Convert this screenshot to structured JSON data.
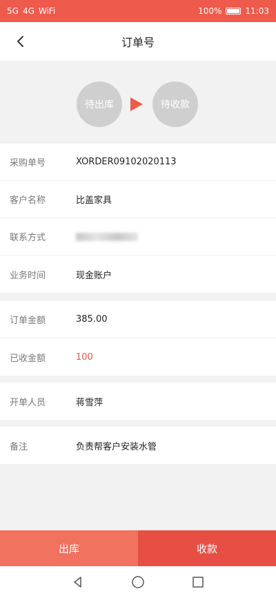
{
  "status_bar": {
    "left": [
      "5G",
      "4G",
      "WiFi"
    ],
    "battery": "100%",
    "time": "11:03"
  },
  "header": {
    "title": "订单号"
  },
  "flow": {
    "step1": "待出库",
    "step2": "待收款"
  },
  "info": [
    {
      "label": "采购单号",
      "value": "XORDER09102020113"
    },
    {
      "label": "客户名称",
      "value": "比盖家具"
    },
    {
      "label": "联系方式",
      "value": ""
    },
    {
      "label": "业务时间",
      "value": "现金账户"
    }
  ],
  "amounts": [
    {
      "label": "订单金额",
      "value": "385.00"
    },
    {
      "label": "已收金额",
      "value": "100"
    }
  ],
  "staff": [
    {
      "label": "开单人员",
      "value": "蒋雪萍"
    }
  ],
  "remark": [
    {
      "label": "备注",
      "value": "负责帮客户安装水管"
    }
  ],
  "actions": {
    "out": "出库",
    "pay": "收款"
  },
  "colors": {
    "accent": "#ee5a4b",
    "received_amount": "#e15747"
  }
}
